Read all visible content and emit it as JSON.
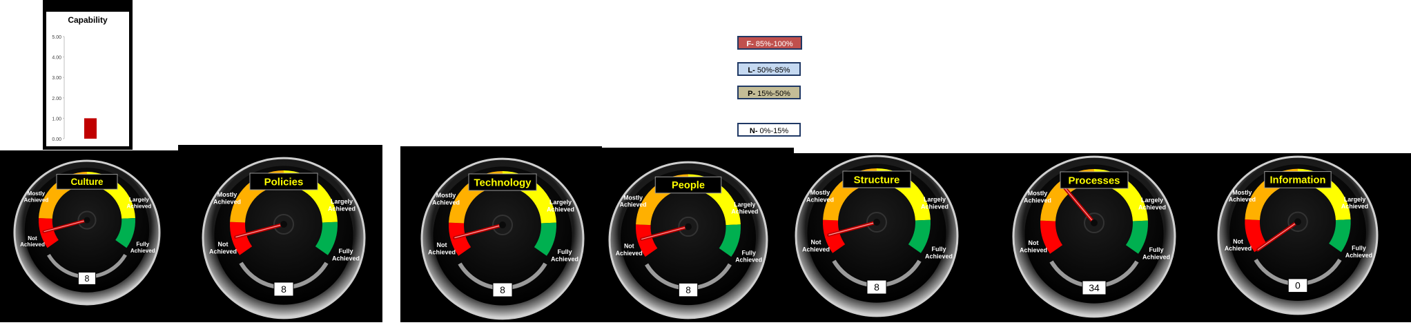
{
  "capability_chart": {
    "chart_data": {
      "type": "bar",
      "title": "Capability",
      "categories": [
        ""
      ],
      "values": [
        1.0
      ],
      "ylim": [
        0,
        5
      ],
      "yticks": [
        "5.00",
        "4.00",
        "3.00",
        "2.00",
        "1.00",
        "0.00"
      ],
      "bar_color": "#c00000"
    }
  },
  "legend": [
    {
      "key": "F-",
      "text": "85%-100%",
      "bg": "#c0504d",
      "color": "#ffffff"
    },
    {
      "key": "L-",
      "text": "50%-85%",
      "bg": "#c5d9f1",
      "color": "#000000"
    },
    {
      "key": "P-",
      "text": "15%-50%",
      "bg": "#c4bd97",
      "color": "#000000"
    },
    {
      "key": "N-",
      "text": "0%-15%",
      "bg": "#ffffff",
      "color": "#000000"
    }
  ],
  "zone_labels": {
    "not": [
      "Not",
      "Achieved"
    ],
    "mostly": [
      "Mostly",
      "Achieved"
    ],
    "largely": [
      "Largely",
      "Achieved"
    ],
    "fully": [
      "Fully",
      "Achieved"
    ]
  },
  "zone_colors": {
    "red": "#ff0000",
    "orange": "#ffb000",
    "yellow": "#ffff00",
    "green": "#00b050"
  },
  "gauges": [
    {
      "title": "Culture",
      "value": "8",
      "needle_value": 8
    },
    {
      "title": "Policies",
      "value": "8",
      "needle_value": 8
    },
    {
      "title": "Technology",
      "value": "8",
      "needle_value": 8
    },
    {
      "title": "People",
      "value": "8",
      "needle_value": 8
    },
    {
      "title": "Structure",
      "value": "8",
      "needle_value": 8
    },
    {
      "title": "Processes",
      "value": "34",
      "needle_value": 34
    },
    {
      "title": "Information",
      "value": "0",
      "needle_value": 0
    }
  ]
}
